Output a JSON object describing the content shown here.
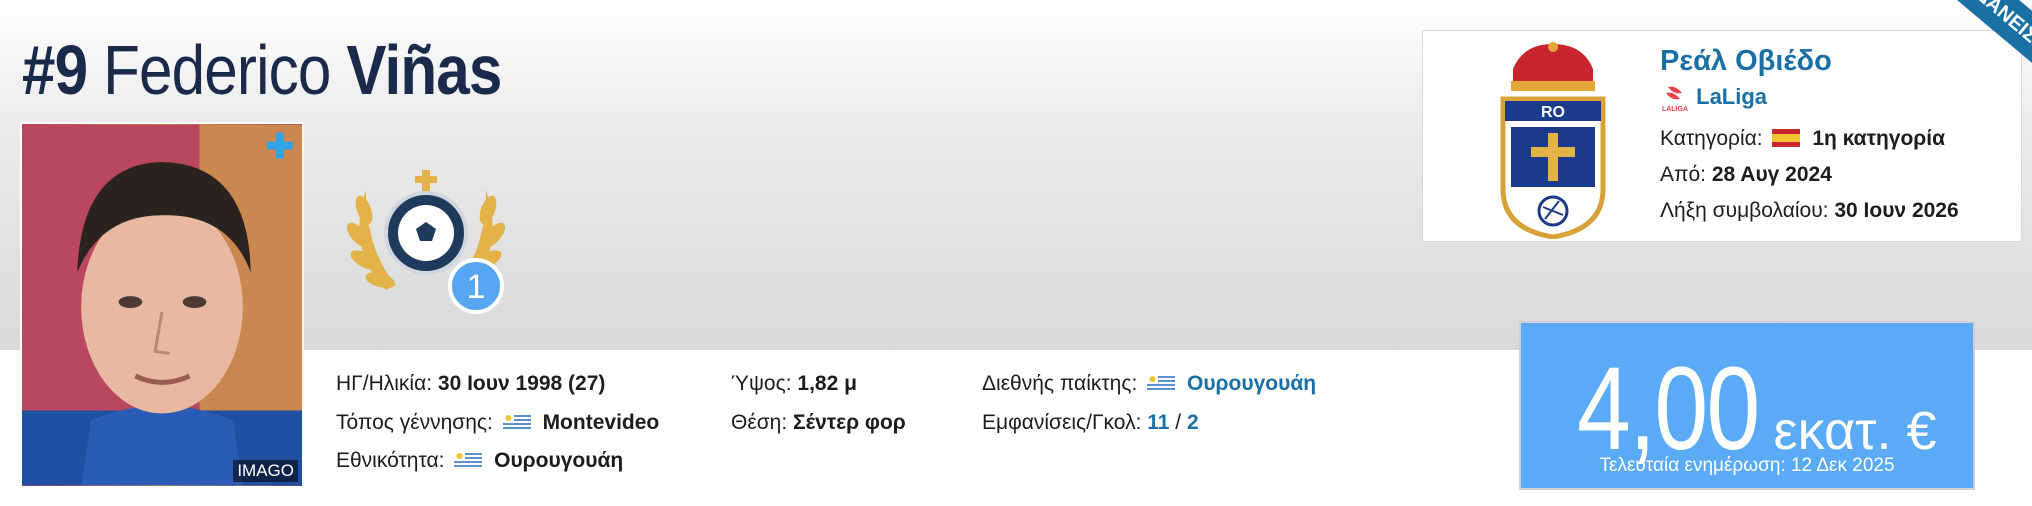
{
  "player": {
    "shirt_number": "#9",
    "first_name": "Federico",
    "last_name": "Viñas",
    "photo_credit": "IMAGO"
  },
  "badge": {
    "count": "1"
  },
  "info": {
    "dob_label": "ΗΓ/Ηλικία:",
    "dob_value": "30 Ιουν 1998 (27)",
    "birthplace_label": "Τόπος γέννησης:",
    "birthplace_value": "Montevideo",
    "citizenship_label": "Εθνικότητα:",
    "citizenship_value": "Ουρουγουάη",
    "height_label": "Ύψος:",
    "height_value": "1,82 μ",
    "position_label": "Θέση:",
    "position_value": "Σέντερ φορ",
    "intl_label": "Διεθνής παίκτης:",
    "intl_value": "Ουρουγουάη",
    "caps_label": "Εμφανίσεις/Γκολ:",
    "caps_value": "11",
    "caps_sep": "/",
    "goals_value": "2"
  },
  "club": {
    "name": "Ρεάλ Οβιέδο",
    "league": "LaLiga",
    "league_logo_text": "LALIGA",
    "crest_text": "RO",
    "tier_label": "Κατηγορία:",
    "tier_value": "1η κατηγορία",
    "joined_label": "Από:",
    "joined_value": "28 Αυγ 2024",
    "contract_label": "Λήξη συμβολαίου:",
    "contract_value": "30 Ιουν 2026"
  },
  "corner_ribbon": "ΤΟ ΔΑΝΕΙΣΜ",
  "market_value": {
    "amount": "4,00",
    "unit": "εκατ. €",
    "updated": "Τελευταία ενημέρωση: 12 Δεκ 2025"
  },
  "colors": {
    "link": "#1a6fa5",
    "value_box": "#5aaaf5",
    "title": "#1a2a4a",
    "badge_gold": "#e3b34a",
    "badge_blue": "#57a6f2"
  },
  "icons": {
    "uruguay_flag": "uruguay-flag-icon",
    "spain_flag": "spain-flag-icon",
    "laliga": "laliga-logo-icon",
    "add": "plus-icon"
  }
}
